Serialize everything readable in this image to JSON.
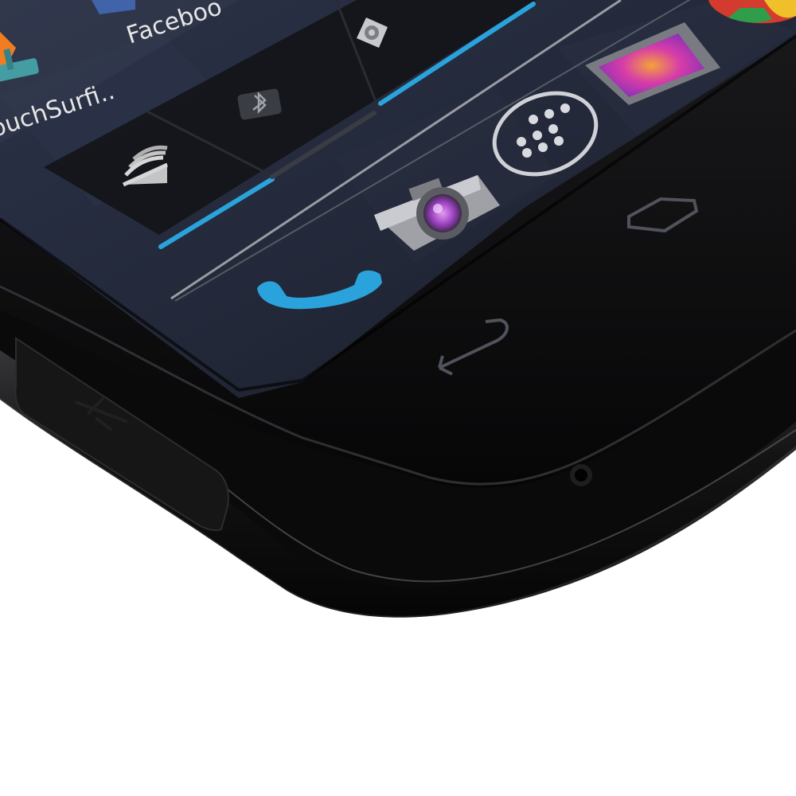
{
  "scene": "Close-up photo of the bottom corner of an Android smartphone showing the home screen",
  "home_screen": {
    "apps": [
      {
        "label": "Faceboo",
        "icon": "facebook-icon"
      },
      {
        "label": "ouchSurfi..",
        "icon": "couchsurfing-icon"
      }
    ]
  },
  "power_control_widget": {
    "toggles": [
      {
        "icon": "wifi-icon",
        "state": "on"
      },
      {
        "icon": "bluetooth-icon",
        "state": "off"
      },
      {
        "icon": "gps-icon",
        "state": "on"
      }
    ]
  },
  "dock": {
    "items": [
      {
        "icon": "phone-icon"
      },
      {
        "icon": "camera-icon"
      },
      {
        "icon": "app-drawer-icon"
      },
      {
        "icon": "gallery-icon"
      },
      {
        "icon": "chrome-icon"
      }
    ]
  },
  "nav_bar": {
    "buttons": [
      {
        "icon": "back-icon"
      },
      {
        "icon": "home-icon"
      }
    ]
  },
  "colors": {
    "accent_blue": "#2aa3dc",
    "wallpaper": "#252a3a",
    "body": "#0b0b0c",
    "background": "#ffffff"
  }
}
